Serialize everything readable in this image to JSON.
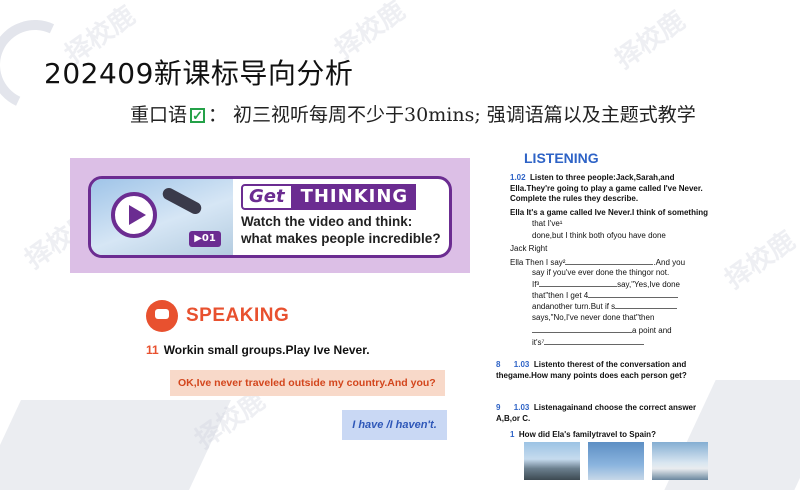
{
  "slide": {
    "title": "202409新课标导向分析",
    "subtitle_prefix": "重口语",
    "subtitle_rest": "：  初三视听每周不少于30mins; 强调语篇以及主题式教学",
    "watermark": "择校鹿"
  },
  "get_thinking": {
    "get": "Get",
    "thinking": "THINKING",
    "badge": "01",
    "prompt_line1": "Watch the video and think:",
    "prompt_line2": "what makes people incredible?"
  },
  "speaking": {
    "title": "SPEAKING",
    "task_number": "11",
    "task_text": "Workin small groups.Play Ive Never.",
    "bubble1": "OK,Ive never traveled outside my country.And you?",
    "bubble2": "I have /I haven't."
  },
  "listening": {
    "title": "LISTENING",
    "q1_code": "1.02",
    "q1_text": "Listen to three people:Jack,Sarah,and Ella.They're going to play a game called I've Never. Complete the rules they describe.",
    "ella1": "Ella It's a game called Ive Never.I think of something",
    "ella1b": "that I've¹",
    "ella1c": "done,but I think both ofyou have done",
    "jack": "Jack   Right",
    "ella2a": "Ella   Then  I  say²",
    "ella2b": ".And  you",
    "ella2c": "say  if you've ever done the thingor not.",
    "ella2d": "If³",
    "ella2e": "say,\"Yes,Ive done",
    "ella2f": "that\"then  I  get  4",
    "ella2g": "andanother turn.But if s",
    "ella2h": "says,\"No,I've  never  done  that\"then",
    "ella2i": "a point and",
    "ella2j": "it's⁷",
    "q2_num": "8",
    "q2_code": "1.03",
    "q2_text": "Listento therest of the conversation and thegame.How many points does each person get?",
    "q3_num": "9",
    "q3_code": "1.03",
    "q3_text": "Listenagainand choose the correct answer  A,B,or  C.",
    "q3_item_num": "1",
    "q3_item": "How did Ela's familytravel to Spain?"
  }
}
